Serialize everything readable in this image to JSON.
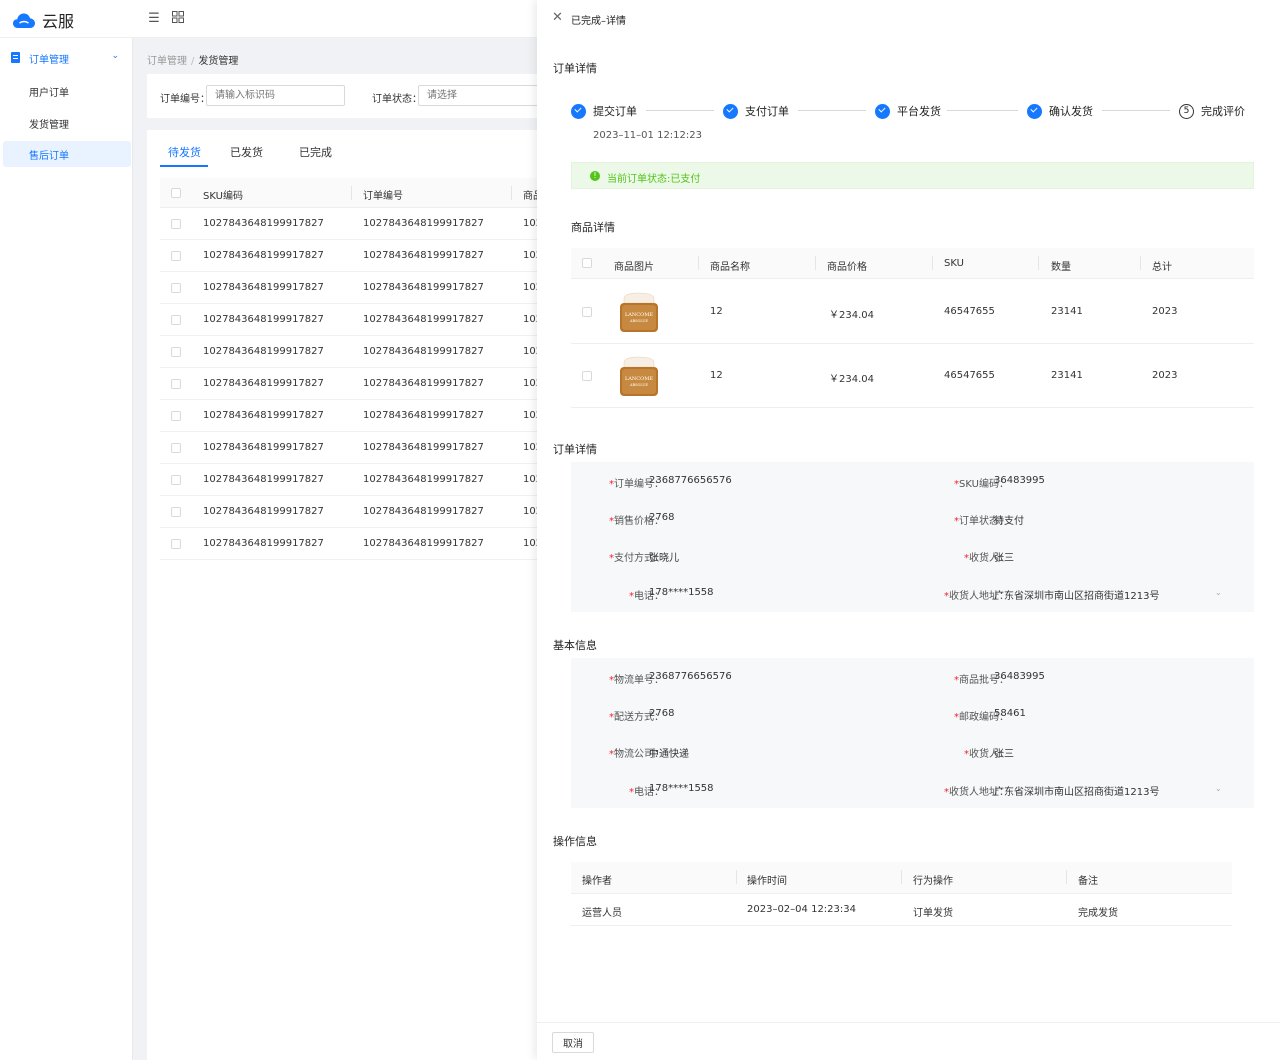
{
  "app": {
    "name": "云服"
  },
  "sidebar": {
    "group": "订单管理",
    "items": [
      {
        "label": "用户订单"
      },
      {
        "label": "发货管理"
      },
      {
        "label": "售后订单"
      }
    ]
  },
  "breadcrumb": {
    "parent": "订单管理",
    "separator": "/",
    "current": "发货管理"
  },
  "filters": {
    "order_no_label": "订单编号：",
    "order_no_placeholder": "请输入标识码",
    "status_label": "订单状态：",
    "status_placeholder": "请选择"
  },
  "list": {
    "tabs": [
      "待发货",
      "已发货",
      "已完成"
    ],
    "columns": [
      "SKU编码",
      "订单编号",
      "商品"
    ],
    "rows": [
      [
        "1027843648199917827",
        "1027843648199917827",
        "102"
      ],
      [
        "1027843648199917827",
        "1027843648199917827",
        "102"
      ],
      [
        "1027843648199917827",
        "1027843648199917827",
        "102"
      ],
      [
        "1027843648199917827",
        "1027843648199917827",
        "102"
      ],
      [
        "1027843648199917827",
        "1027843648199917827",
        "102"
      ],
      [
        "1027843648199917827",
        "1027843648199917827",
        "102"
      ],
      [
        "1027843648199917827",
        "1027843648199917827",
        "102"
      ],
      [
        "1027843648199917827",
        "1027843648199917827",
        "102"
      ],
      [
        "1027843648199917827",
        "1027843648199917827",
        "102"
      ],
      [
        "1027843648199917827",
        "1027843648199917827",
        "102"
      ],
      [
        "1027843648199917827",
        "1027843648199917827",
        "102"
      ]
    ]
  },
  "drawer": {
    "title": "已完成–详情",
    "order_section": "订单详情",
    "steps": [
      {
        "label": "提交订单",
        "done": true
      },
      {
        "label": "支付订单",
        "done": true
      },
      {
        "label": "平台发货",
        "done": true
      },
      {
        "label": "确认发货",
        "done": true
      },
      {
        "label": "完成评价",
        "done": false,
        "num": "5"
      }
    ],
    "step_time": "2023–11–01 12:12:23",
    "alert": "当前订单状态:已支付",
    "goods_title": "商品详情",
    "goods_columns": [
      "商品图片",
      "商品名称",
      "商品价格",
      "SKU",
      "数量",
      "总计"
    ],
    "goods_rows": [
      {
        "name": "12",
        "price": "￥234.04",
        "sku": "46547655",
        "qty": "23141",
        "total": "2023"
      },
      {
        "name": "12",
        "price": "￥234.04",
        "sku": "46547655",
        "qty": "23141",
        "total": "2023"
      }
    ],
    "product_brand": "LANCOME",
    "product_line": "ABSOLUE",
    "order_detail_title": "订单详情",
    "order_detail": {
      "left": [
        {
          "label": "订单编号：",
          "value": "2368776656576"
        },
        {
          "label": "销售价格：",
          "value": "2768"
        },
        {
          "label": "支付方式：",
          "value": "张晓儿"
        },
        {
          "label": "电话：",
          "value": "178****1558"
        }
      ],
      "right": [
        {
          "label": "SKU编码：",
          "value": "36483995"
        },
        {
          "label": "订单状态：",
          "value": "待支付"
        },
        {
          "label": "收货人：",
          "value": "张三"
        },
        {
          "label": "收货人地址：",
          "value": "广东省深圳市南山区招商街道1213号"
        }
      ]
    },
    "basic_title": "基本信息",
    "basic_info": {
      "left": [
        {
          "label": "物流单号：",
          "value": "2368776656576"
        },
        {
          "label": "配送方式：",
          "value": "2768"
        },
        {
          "label": "物流公司：",
          "value": "中通快递"
        },
        {
          "label": "电话：",
          "value": "178****1558"
        }
      ],
      "right": [
        {
          "label": "商品批号：",
          "value": "36483995"
        },
        {
          "label": "邮政编码：",
          "value": "58461"
        },
        {
          "label": "收货人：",
          "value": "张三"
        },
        {
          "label": "收货人地址：",
          "value": "广东省深圳市南山区招商街道1213号"
        }
      ]
    },
    "ops_title": "操作信息",
    "ops_columns": [
      "操作者",
      "操作时间",
      "行为操作",
      "备注"
    ],
    "ops_rows": [
      [
        "运营人员",
        "2023–02–04 12:23:34",
        "订单发货",
        "完成发货"
      ]
    ],
    "cancel_label": "取消"
  },
  "colors": {
    "primary": "#1677ff",
    "success": "#52c41a",
    "required": "#f5222d",
    "product_gold": "#b8742a"
  }
}
